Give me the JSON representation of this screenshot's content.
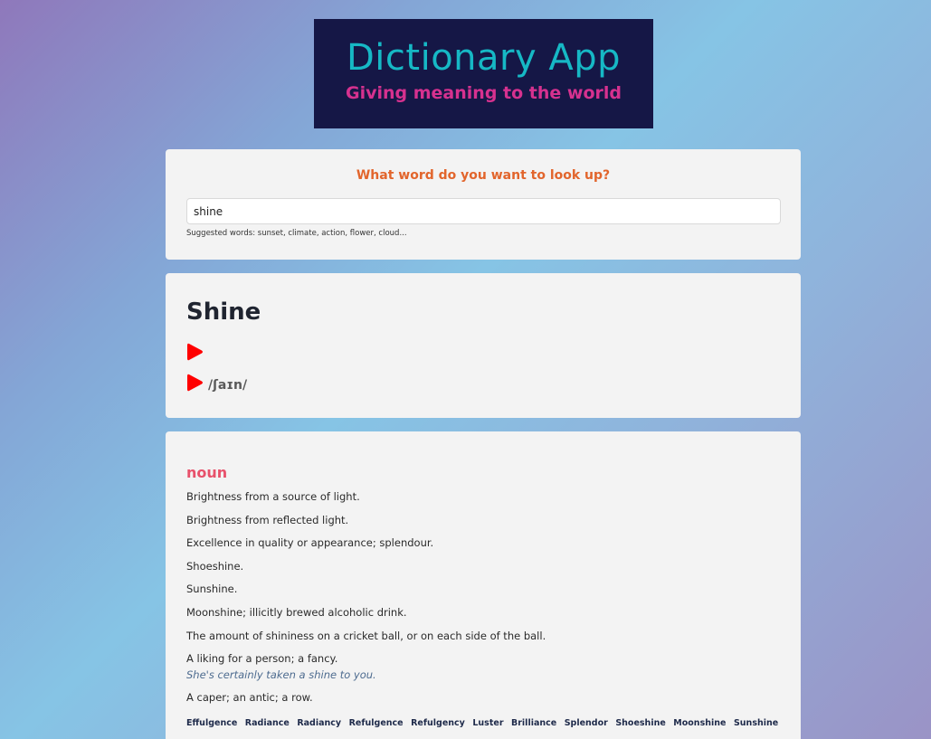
{
  "logo": {
    "title": "Dictionary App",
    "subtitle": "Giving meaning to the world",
    "colors": {
      "background": "#151746",
      "title": "#16b8c5",
      "subtitle": "#d6318f"
    }
  },
  "search": {
    "heading": "What word do you want to look up?",
    "value": "shine",
    "suggested": "Suggested words: sunset, climate, action, flower, cloud..."
  },
  "word": {
    "title": "Shine",
    "phonetic": "/ʃaɪn/",
    "icons": [
      "play-icon",
      "play-icon"
    ]
  },
  "meaning": {
    "part_of_speech": "noun",
    "definitions": [
      {
        "text": "Brightness from a source of light."
      },
      {
        "text": "Brightness from reflected light."
      },
      {
        "text": "Excellence in quality or appearance; splendour."
      },
      {
        "text": "Shoeshine."
      },
      {
        "text": "Sunshine."
      },
      {
        "text": "Moonshine; illicitly brewed alcoholic drink."
      },
      {
        "text": "The amount of shininess on a cricket ball, or on each side of the ball."
      },
      {
        "text": "A liking for a person; a fancy.",
        "example": "She's certainly taken a shine to you."
      },
      {
        "text": "A caper; an antic; a row."
      }
    ],
    "synonyms": [
      "Effulgence",
      "Radiance",
      "Radiancy",
      "Refulgence",
      "Refulgency",
      "Luster",
      "Brilliance",
      "Splendor",
      "Shoeshine",
      "Moonshine",
      "Sunshine"
    ]
  },
  "colors": {
    "heading": "#e2652c",
    "part_of_speech": "#e8516b",
    "play": "#ff0000",
    "example": "#4d6b8f"
  }
}
